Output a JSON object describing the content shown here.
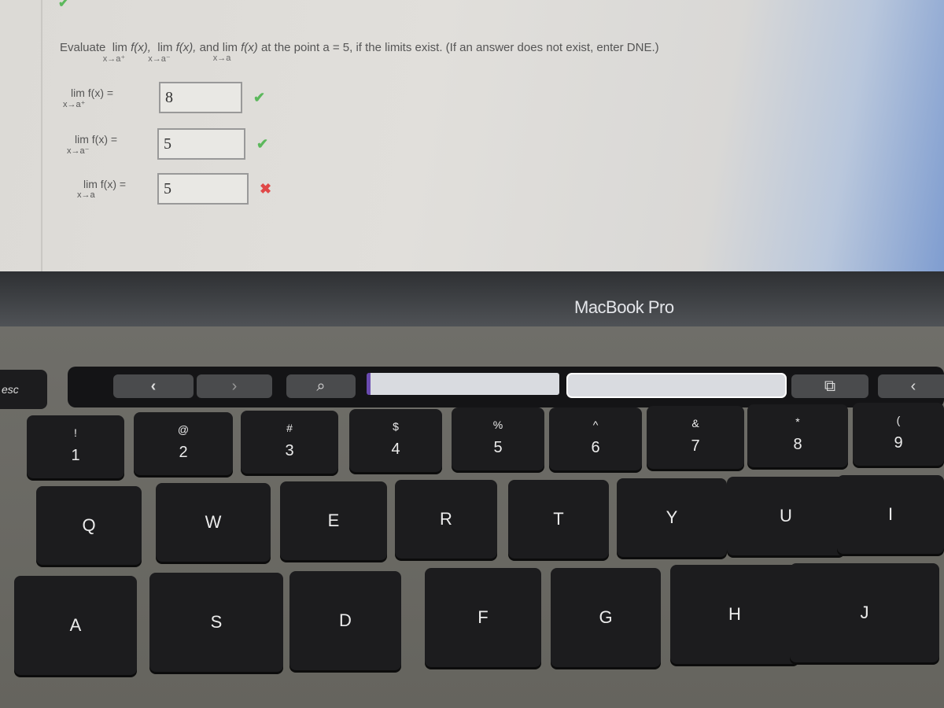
{
  "question": {
    "prefix": "Evaluate",
    "lim": "lim",
    "fx": "f(x),",
    "fx_last": "f(x)",
    "sub_right": "x→a⁺",
    "sub_left": "x→a⁻",
    "sub_both": "x→a",
    "and": "and",
    "suffix": "at the point a = 5, if the limits exist. (If an answer does not exist, enter DNE.)"
  },
  "answers": [
    {
      "label": "lim  f(x)  =",
      "sub": "x→a⁺",
      "value": "8",
      "status": "correct",
      "status_icon": "✔"
    },
    {
      "label": "lim  f(x)  =",
      "sub": "x→a⁻",
      "value": "5",
      "status": "correct",
      "status_icon": "✔"
    },
    {
      "label": "lim  f(x)  =",
      "sub": "x→a",
      "value": "5",
      "status": "incorrect",
      "status_icon": "✖"
    }
  ],
  "top_mark": "✔",
  "device_brand": "MacBook Pro",
  "touchbar": {
    "back": "‹",
    "forward": "›",
    "search": "⌕",
    "new_tab": "⧉",
    "extra": "‹"
  },
  "keyboard": {
    "esc": "esc",
    "number_row": [
      {
        "top": "!",
        "bot": "1"
      },
      {
        "top": "@",
        "bot": "2"
      },
      {
        "top": "#",
        "bot": "3"
      },
      {
        "top": "$",
        "bot": "4"
      },
      {
        "top": "%",
        "bot": "5"
      },
      {
        "top": "^",
        "bot": "6"
      },
      {
        "top": "&",
        "bot": "7"
      },
      {
        "top": "*",
        "bot": "8"
      },
      {
        "top": "(",
        "bot": "9"
      }
    ],
    "qwerty_row": [
      "Q",
      "W",
      "E",
      "R",
      "T",
      "Y",
      "U",
      "I"
    ],
    "home_row": [
      "A",
      "S",
      "D",
      "F",
      "G",
      "H",
      "J"
    ]
  },
  "colors": {
    "correct": "#5cb85c",
    "incorrect": "#e04848"
  }
}
